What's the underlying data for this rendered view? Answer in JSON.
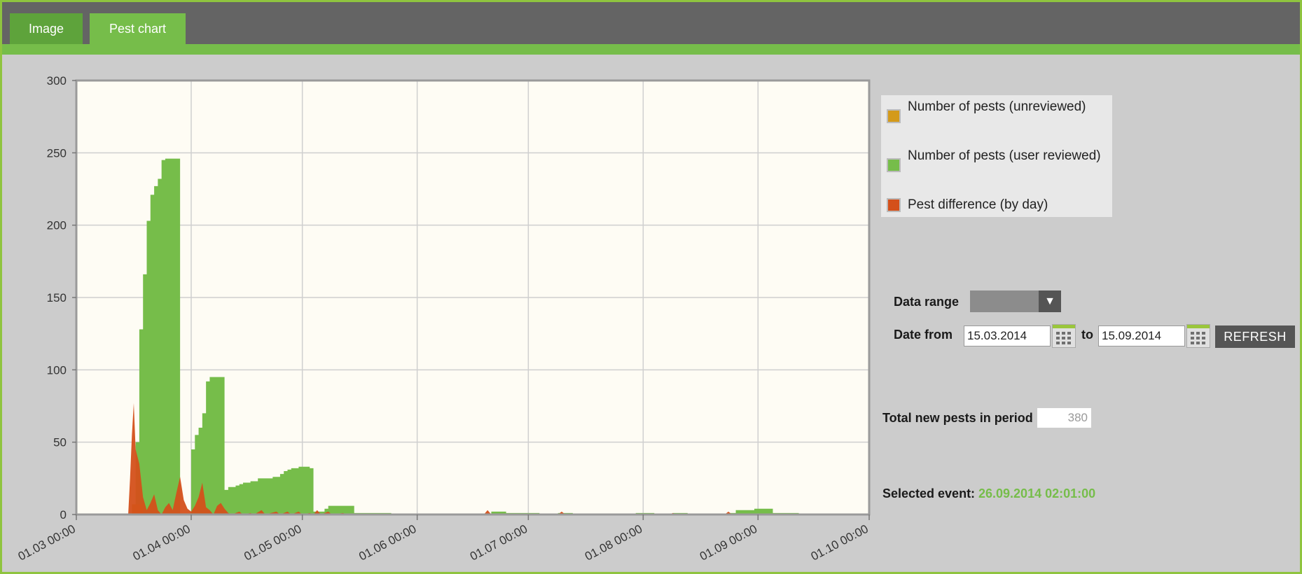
{
  "tabs": [
    {
      "label": "Image"
    },
    {
      "label": "Pest chart"
    }
  ],
  "colors": {
    "unreviewed": "#d49a1a",
    "reviewed": "#76bd4a",
    "difference": "#d4501a",
    "plot_bg": "#fefcf4",
    "grid": "#cfcfcf"
  },
  "legend": {
    "items": [
      {
        "label": "Number of pests (unreviewed)",
        "color": "#d49a1a"
      },
      {
        "label": "Number of pests (user reviewed)",
        "color": "#76bd4a"
      },
      {
        "label": "Pest difference (by day)",
        "color": "#d4501a"
      }
    ]
  },
  "controls": {
    "data_range_label": "Data range",
    "date_from_label": "Date from",
    "date_from": "15.03.2014",
    "to_label": "to",
    "date_to": "15.09.2014",
    "refresh_label": "REFRESH",
    "total_label": "Total new pests in period",
    "total_value": "380",
    "selected_label": "Selected event:",
    "selected_value": "26.09.2014 02:01:00"
  },
  "chart_data": {
    "type": "area",
    "title": "",
    "xlabel": "",
    "ylabel": "",
    "x_ticks": [
      "01.03 00:00",
      "01.04 00:00",
      "01.05 00:00",
      "01.06 00:00",
      "01.07 00:00",
      "01.08 00:00",
      "01.09 00:00",
      "01.10 00:00"
    ],
    "x_range_days": [
      0,
      214
    ],
    "ylim": [
      0,
      300
    ],
    "y_ticks": [
      0,
      50,
      100,
      150,
      200,
      250,
      300
    ],
    "grid": true,
    "legend_position": "right",
    "series": [
      {
        "name": "Number of pests (user reviewed)",
        "color": "#76bd4a",
        "step": true,
        "points": [
          [
            15,
            0
          ],
          [
            16,
            50
          ],
          [
            17,
            128
          ],
          [
            18,
            166
          ],
          [
            19,
            203
          ],
          [
            20,
            221
          ],
          [
            21,
            227
          ],
          [
            22,
            232
          ],
          [
            23,
            245
          ],
          [
            24,
            246
          ],
          [
            27,
            246
          ],
          [
            28,
            0
          ],
          [
            31,
            45
          ],
          [
            32,
            55
          ],
          [
            33,
            60
          ],
          [
            34,
            70
          ],
          [
            35,
            92
          ],
          [
            36,
            95
          ],
          [
            39,
            95
          ],
          [
            40,
            17
          ],
          [
            41,
            19
          ],
          [
            43,
            20
          ],
          [
            44,
            21
          ],
          [
            45,
            22
          ],
          [
            47,
            23
          ],
          [
            49,
            25
          ],
          [
            53,
            26
          ],
          [
            55,
            28
          ],
          [
            56,
            30
          ],
          [
            57,
            31
          ],
          [
            58,
            32
          ],
          [
            60,
            33
          ],
          [
            63,
            32
          ],
          [
            64,
            2
          ],
          [
            67,
            4
          ],
          [
            68,
            6
          ],
          [
            74,
            6
          ],
          [
            75,
            1
          ],
          [
            80,
            1
          ],
          [
            85,
            0
          ],
          [
            111,
            0
          ],
          [
            112,
            2
          ],
          [
            116,
            1
          ],
          [
            124,
            1
          ],
          [
            125,
            0
          ],
          [
            129,
            0
          ],
          [
            130,
            1
          ],
          [
            134,
            0
          ],
          [
            150,
            0
          ],
          [
            151,
            1
          ],
          [
            156,
            0
          ],
          [
            160,
            0
          ],
          [
            161,
            1
          ],
          [
            165,
            0
          ],
          [
            175,
            0
          ],
          [
            176,
            1
          ],
          [
            178,
            3
          ],
          [
            182,
            3
          ],
          [
            183,
            4
          ],
          [
            187,
            4
          ],
          [
            188,
            1
          ],
          [
            194,
            1
          ],
          [
            195,
            0
          ],
          [
            214,
            0
          ]
        ]
      },
      {
        "name": "Number of pests (unreviewed)",
        "color": "#d49a1a",
        "step": true,
        "points": [
          [
            14,
            0
          ],
          [
            15,
            7
          ],
          [
            17,
            7
          ],
          [
            18,
            0
          ],
          [
            214,
            0
          ]
        ]
      },
      {
        "name": "Pest difference (by day)",
        "color": "#d4501a",
        "step": false,
        "points": [
          [
            14,
            0
          ],
          [
            14.5,
            25
          ],
          [
            15,
            55
          ],
          [
            15.5,
            77
          ],
          [
            16,
            45
          ],
          [
            17,
            35
          ],
          [
            18,
            12
          ],
          [
            19,
            3
          ],
          [
            20,
            8
          ],
          [
            21,
            14
          ],
          [
            22,
            3
          ],
          [
            23,
            0
          ],
          [
            24,
            5
          ],
          [
            25,
            8
          ],
          [
            26,
            3
          ],
          [
            27,
            15
          ],
          [
            28,
            26
          ],
          [
            29,
            10
          ],
          [
            30,
            4
          ],
          [
            31,
            2
          ],
          [
            32,
            6
          ],
          [
            33,
            12
          ],
          [
            34,
            22
          ],
          [
            35,
            5
          ],
          [
            36,
            3
          ],
          [
            37,
            0
          ],
          [
            38,
            6
          ],
          [
            39,
            8
          ],
          [
            40,
            4
          ],
          [
            41,
            1
          ],
          [
            42,
            0
          ],
          [
            44,
            2
          ],
          [
            45,
            0
          ],
          [
            47,
            1
          ],
          [
            48,
            0
          ],
          [
            50,
            3
          ],
          [
            51,
            0
          ],
          [
            54,
            2
          ],
          [
            55,
            0
          ],
          [
            57,
            2
          ],
          [
            58,
            0
          ],
          [
            60,
            2
          ],
          [
            61,
            0
          ],
          [
            63,
            1
          ],
          [
            64,
            0
          ],
          [
            65,
            3
          ],
          [
            66,
            0
          ],
          [
            68,
            2
          ],
          [
            69,
            0
          ],
          [
            72,
            1
          ],
          [
            73,
            0
          ],
          [
            110,
            0
          ],
          [
            111,
            3
          ],
          [
            112,
            0
          ],
          [
            130,
            0
          ],
          [
            131,
            2
          ],
          [
            132,
            0
          ],
          [
            160,
            0
          ],
          [
            161,
            1
          ],
          [
            162,
            0
          ],
          [
            175,
            0
          ],
          [
            176,
            2
          ],
          [
            177,
            0
          ],
          [
            214,
            0
          ]
        ]
      }
    ]
  }
}
